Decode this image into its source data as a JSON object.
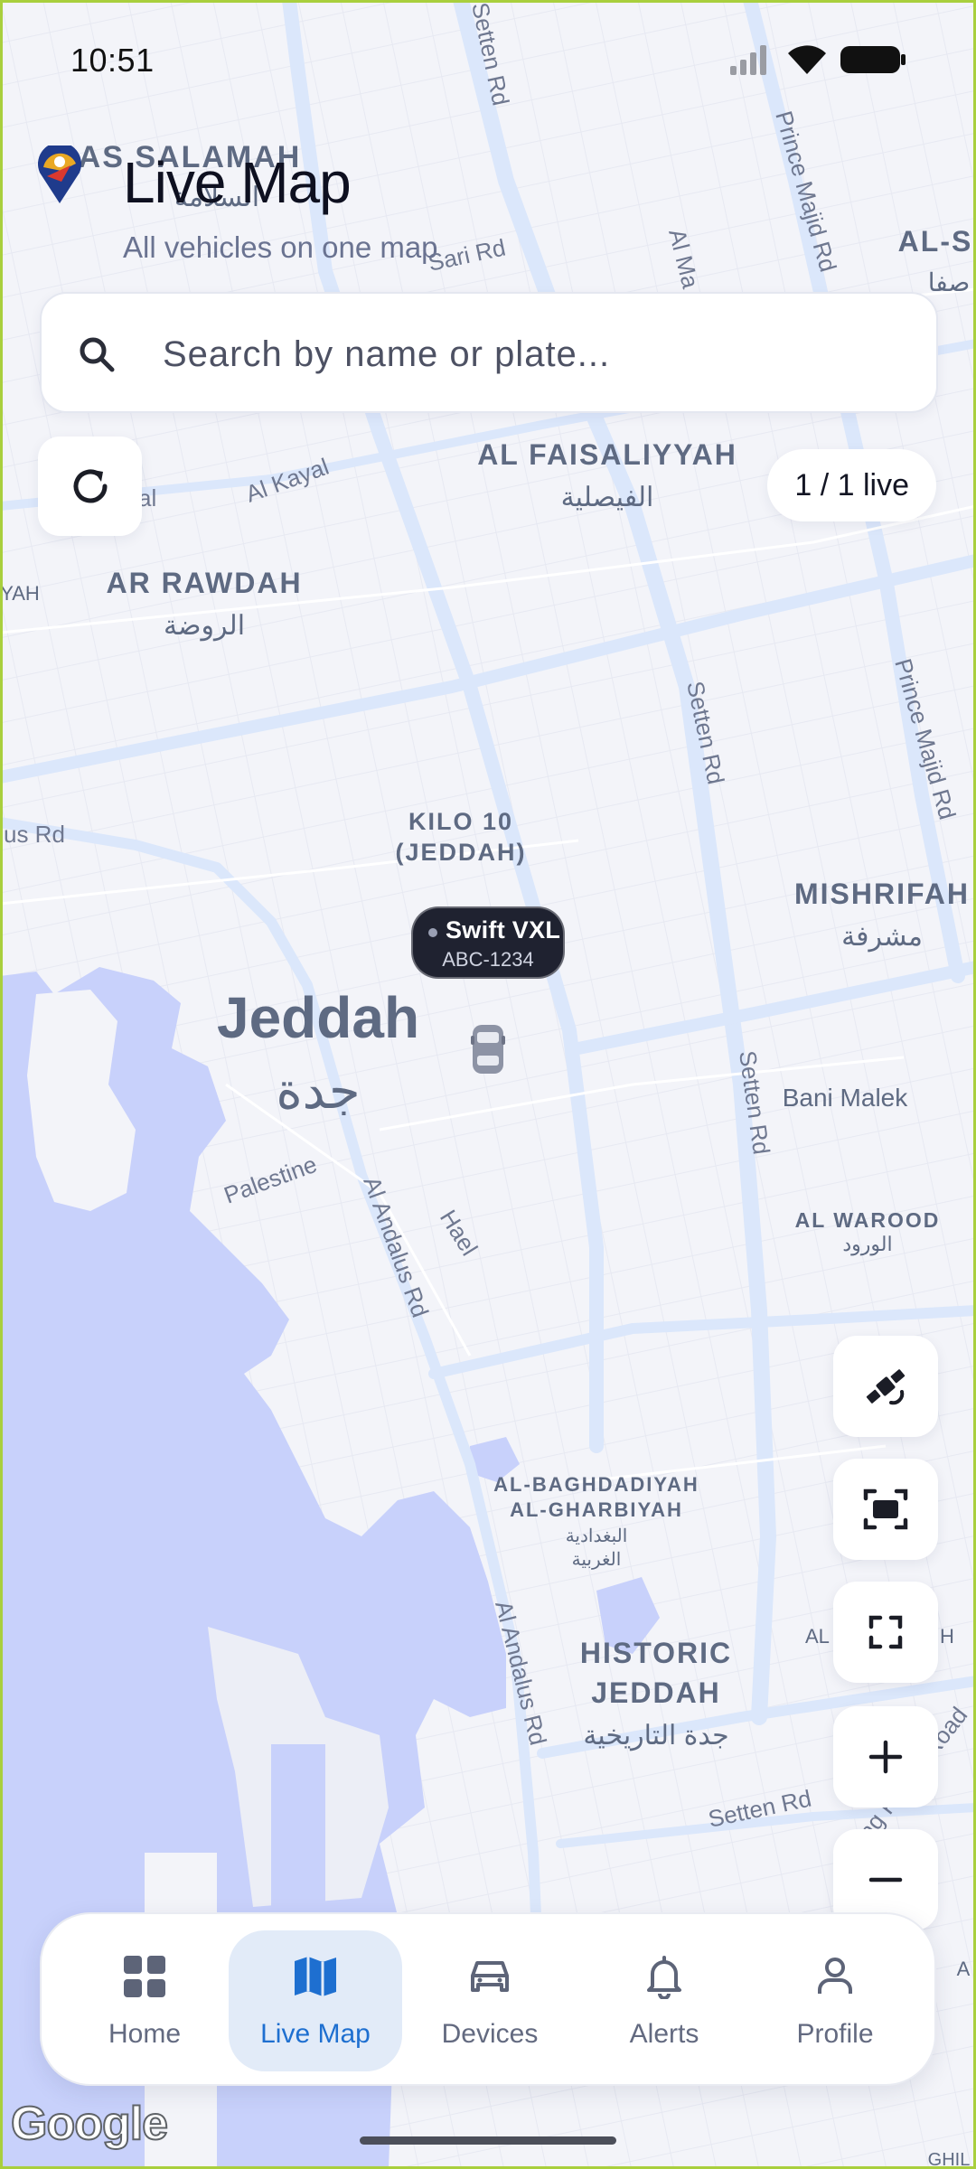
{
  "status": {
    "time": "10:51"
  },
  "header": {
    "title": "Live Map",
    "subtitle": "All vehicles on one map"
  },
  "search": {
    "placeholder": "Search by name or plate..."
  },
  "live_count": "1 / 1 live",
  "vehicle": {
    "name": "Swift VXL",
    "plate": "ABC-1234"
  },
  "map": {
    "labels": {
      "as_salamah": "AS SALAMAH",
      "as_salamah_ar": "السلامة",
      "al_faisaliyyah": "AL FAISALIYYAH",
      "al_faisaliyyah_ar": "الفيصلية",
      "ar_rawdah": "AR RAWDAH",
      "ar_rawdah_ar": "الروضة",
      "kilo10_1": "KILO 10",
      "kilo10_2": "(JEDDAH)",
      "mishrifah": "MISHRIFAH",
      "mishrifah_ar": "مشرفة",
      "jeddah": "Jeddah",
      "jeddah_ar": "جدة",
      "bani_malek": "Bani Malek",
      "al_warood": "AL WAROOD",
      "al_warood_ar": "الورود",
      "baghdadiyah_1": "AL-BAGHDADIYAH",
      "baghdadiyah_2": "AL-GHARBIYAH",
      "baghdadiyah_ar1": "البغدادية",
      "baghdadiyah_ar2": "الغربية",
      "historic_1": "HISTORIC",
      "historic_2": "JEDDAH",
      "historic_ar": "جدة التاريخية",
      "al_s": "AL-S",
      "al_s_ar": "صفا",
      "yah": "YAH",
      "al_h": "AL H",
      "al_h2": "H",
      "ghil": "GHIL",
      "a_edge": "A"
    },
    "roads": {
      "setten_top": "Setten Rd",
      "prince_majid_top": "Prince Majid Rd",
      "sari": "Sari Rd",
      "al_ma": "Al Ma",
      "al_kayal": "Al Kayal",
      "val": "val",
      "setten_mid": "Setten Rd",
      "prince_majid_mid": "Prince Majid Rd",
      "us_rd": "us Rd",
      "setten_low": "Setten Rd",
      "palestine": "Palestine",
      "al_andalus": "Al Andalus Rd",
      "hael": "Hael",
      "al_andalus_low": "Al Andalus Rd",
      "setten_bottom": "Setten Rd",
      "king_khalid": "King Khalid Road"
    }
  },
  "nav": {
    "home": "Home",
    "live_map": "Live Map",
    "devices": "Devices",
    "alerts": "Alerts",
    "profile": "Profile"
  },
  "attribution": "Google"
}
